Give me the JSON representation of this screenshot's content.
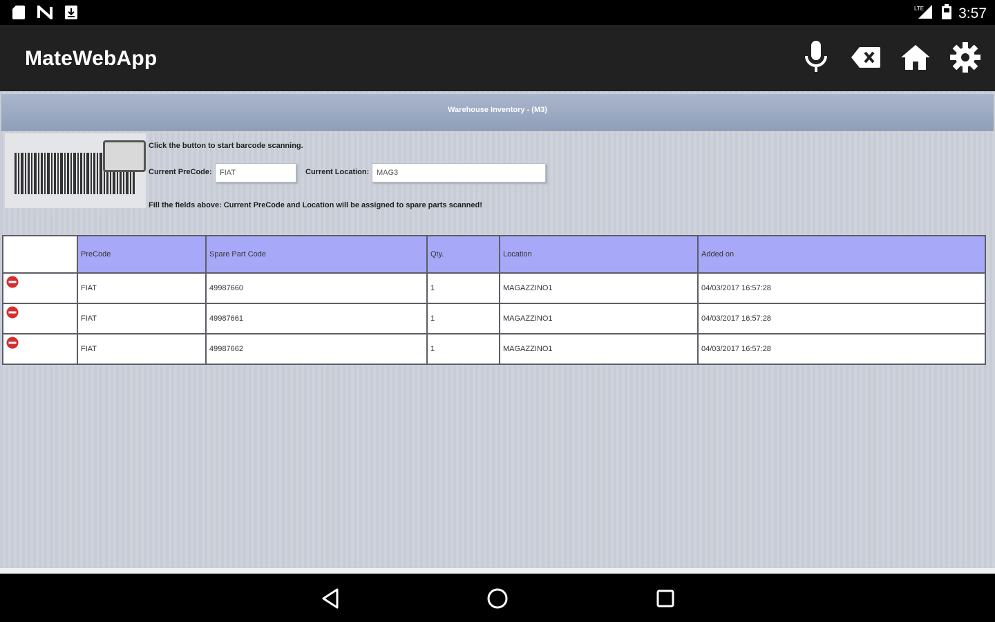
{
  "status_bar": {
    "time": "3:57",
    "network_label": "LTE",
    "left_icons": [
      "sd-card-icon",
      "nfc-icon",
      "download-icon"
    ],
    "right_icons": [
      "signal-icon",
      "battery-icon"
    ]
  },
  "app_bar": {
    "title": "MateWebApp",
    "actions": [
      "microphone-icon",
      "backspace-icon",
      "home-icon",
      "settings-icon"
    ]
  },
  "page": {
    "header_title": "Warehouse Inventory - (M3)",
    "scan_hint": "Click the button to start barcode scanning.",
    "precode_label": "Current PreCode:",
    "precode_value": "FIAT",
    "location_label": "Current Location:",
    "location_value": "MAG3",
    "fill_hint": "Fill the fields above: Current PreCode and Location will be assigned to spare parts scanned!"
  },
  "table": {
    "columns": [
      "",
      "PreCode",
      "Spare Part Code",
      "Qty.",
      "Location",
      "Added on"
    ],
    "rows": [
      {
        "precode": "FIAT",
        "spare_part_code": "49987660",
        "qty": "1",
        "location": "MAGAZZINO1",
        "added_on": "04/03/2017 16:57:28"
      },
      {
        "precode": "FIAT",
        "spare_part_code": "49987661",
        "qty": "1",
        "location": "MAGAZZINO1",
        "added_on": "04/03/2017 16:57:28"
      },
      {
        "precode": "FIAT",
        "spare_part_code": "49987662",
        "qty": "1",
        "location": "MAGAZZINO1",
        "added_on": "04/03/2017 16:57:28"
      }
    ]
  },
  "nav_bar": {
    "buttons": [
      "back-icon",
      "home-circle-icon",
      "recents-icon"
    ]
  },
  "colors": {
    "app_bar": "#212121",
    "table_header": "#a7a8f7",
    "header_band": "#8f9fb9",
    "delete_red": "#d32f2f"
  }
}
